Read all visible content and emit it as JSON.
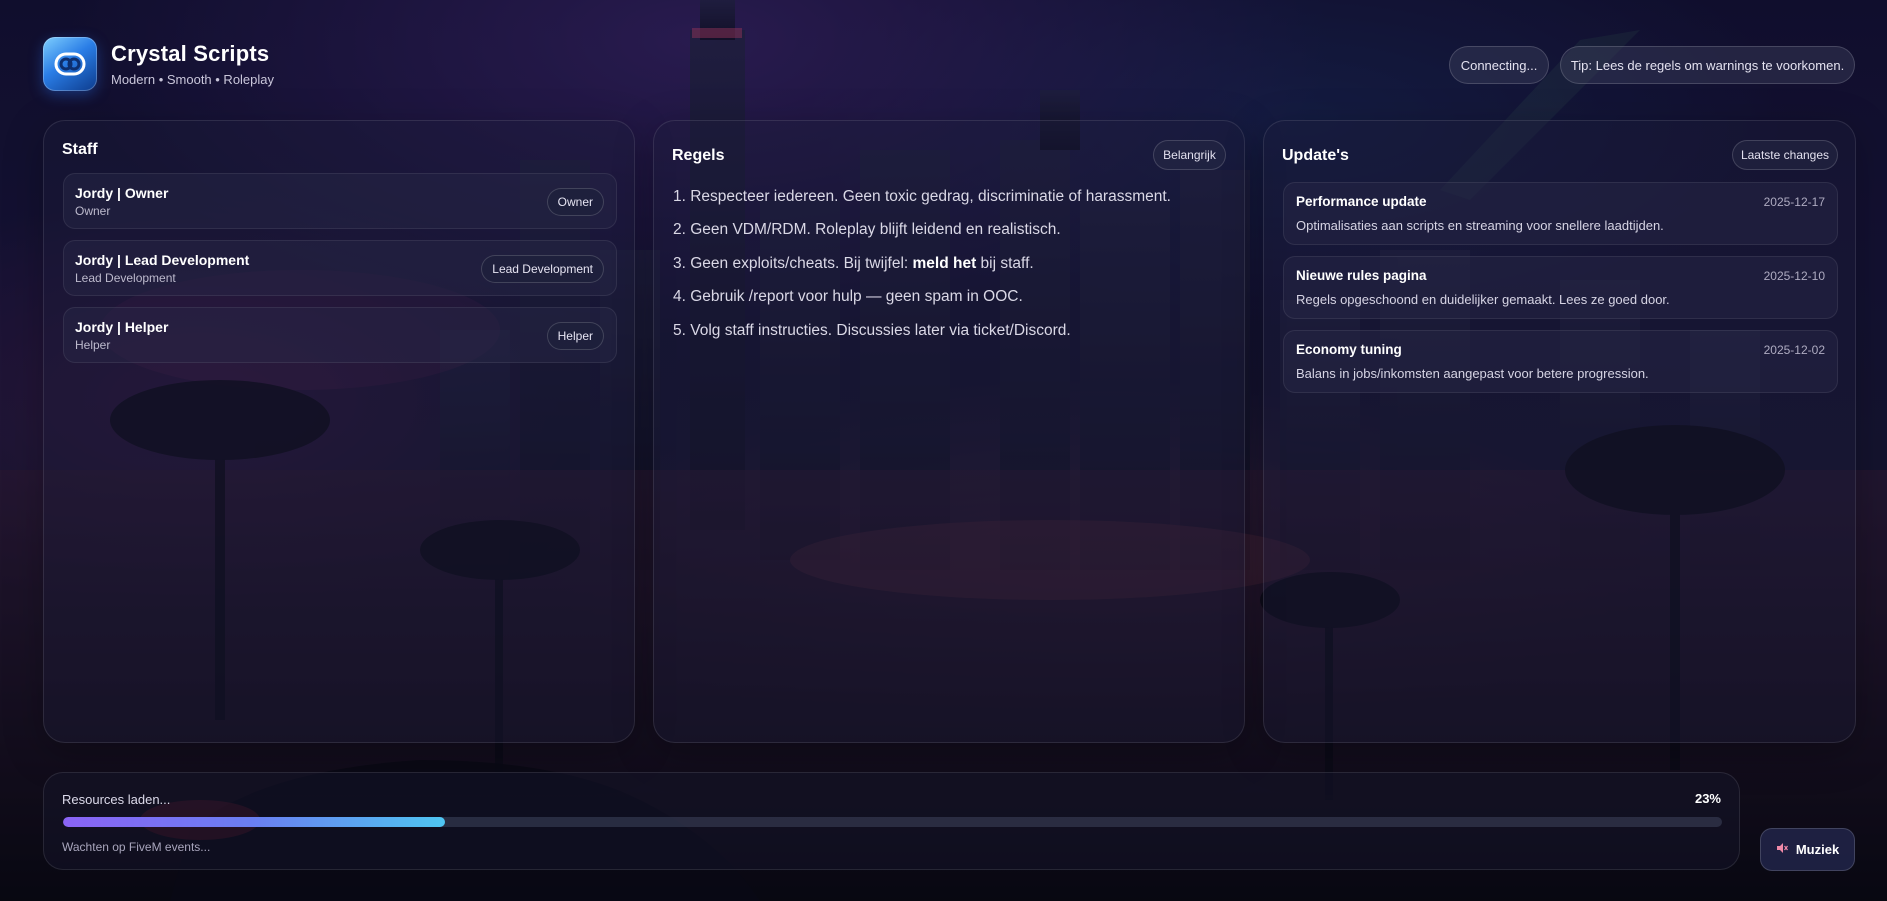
{
  "brand": {
    "title": "Crystal Scripts",
    "subtitle": "Modern • Smooth • Roleplay",
    "logo_icon": "crystal-logo-icon"
  },
  "status": {
    "connecting": "Connecting...",
    "tip": "Tip: Lees de regels om warnings te voorkomen."
  },
  "staff": {
    "title": "Staff",
    "members": [
      {
        "name": "Jordy | Owner",
        "role": "Owner",
        "badge": "Owner"
      },
      {
        "name": "Jordy | Lead Development",
        "role": "Lead Development",
        "badge": "Lead Development"
      },
      {
        "name": "Jordy | Helper",
        "role": "Helper",
        "badge": "Helper"
      }
    ]
  },
  "rules": {
    "title": "Regels",
    "badge": "Belangrijk",
    "items": [
      {
        "text": "1. Respecteer iedereen. Geen toxic gedrag, discriminatie of harassment."
      },
      {
        "text": "2. Geen VDM/RDM. Roleplay blijft leidend en realistisch."
      },
      {
        "before": "3. Geen exploits/cheats. Bij twijfel: ",
        "bold": "meld het",
        "after": " bij staff."
      },
      {
        "text": "4. Gebruik /report voor hulp — geen spam in OOC."
      },
      {
        "text": "5. Volg staff instructies. Discussies later via ticket/Discord."
      }
    ]
  },
  "updates": {
    "title": "Update's",
    "badge": "Laatste changes",
    "items": [
      {
        "title": "Performance update",
        "date": "2025-12-17",
        "desc": "Optimalisaties aan scripts en streaming voor snellere laadtijden."
      },
      {
        "title": "Nieuwe rules pagina",
        "date": "2025-12-10",
        "desc": "Regels opgeschoond en duidelijker gemaakt. Lees ze goed door."
      },
      {
        "title": "Economy tuning",
        "date": "2025-12-02",
        "desc": "Balans in jobs/inkomsten aangepast voor betere progression."
      }
    ]
  },
  "loading": {
    "label": "Resources laden...",
    "percent_text": "23%",
    "progress": 0.23,
    "substatus": "Wachten op FiveM events..."
  },
  "music": {
    "label": "Muziek",
    "icon": "speaker-muted-icon"
  },
  "colors": {
    "progress_start": "#8a63f5",
    "progress_end": "#4fc6f2",
    "logo_blue": "#2a7de6"
  }
}
